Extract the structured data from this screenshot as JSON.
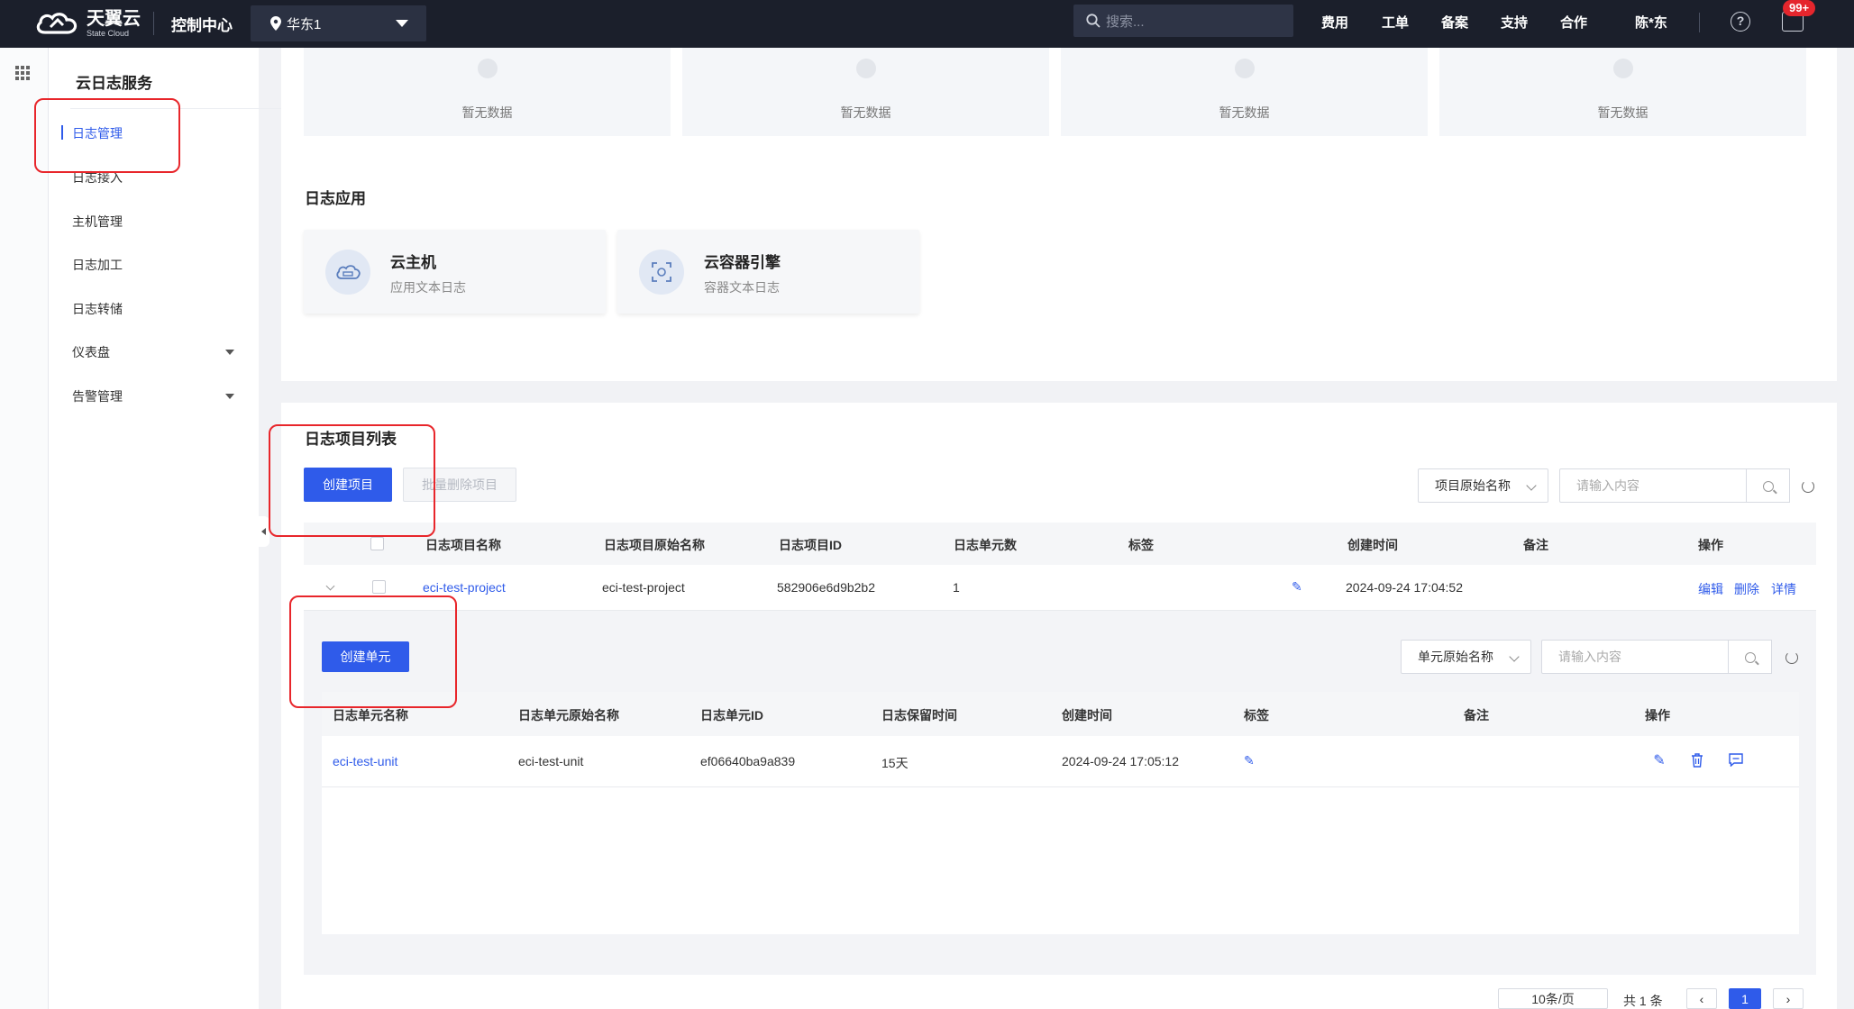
{
  "topbar": {
    "logo_cn": "天翼云",
    "logo_en": "State Cloud",
    "console": "控制中心",
    "region": "华东1",
    "search_placeholder": "搜索...",
    "nav": [
      "费用",
      "工单",
      "备案",
      "支持",
      "合作"
    ],
    "user": "陈*东",
    "badge": "99+",
    "help_glyph": "?"
  },
  "sidebar": {
    "title": "云日志服务",
    "items": [
      {
        "label": "日志管理",
        "active": true
      },
      {
        "label": "日志接入"
      },
      {
        "label": "主机管理"
      },
      {
        "label": "日志加工"
      },
      {
        "label": "日志转储"
      },
      {
        "label": "仪表盘",
        "expandable": true
      },
      {
        "label": "告警管理",
        "expandable": true
      }
    ]
  },
  "overview": {
    "empty_text": [
      "暂无数据",
      "暂无数据",
      "暂无数据",
      "暂无数据"
    ]
  },
  "apps": {
    "title": "日志应用",
    "items": [
      {
        "name": "云主机",
        "desc": "应用文本日志",
        "icon": "cloud-host-icon"
      },
      {
        "name": "云容器引擎",
        "desc": "容器文本日志",
        "icon": "container-engine-icon"
      }
    ]
  },
  "projects": {
    "title": "日志项目列表",
    "create_label": "创建项目",
    "batch_delete_label": "批量删除项目",
    "filter_select": "项目原始名称",
    "search_placeholder": "请输入内容",
    "columns": [
      "日志项目名称",
      "日志项目原始名称",
      "日志项目ID",
      "日志单元数",
      "标签",
      "创建时间",
      "备注",
      "操作"
    ],
    "rows": [
      {
        "name": "eci-test-project",
        "raw_name": "eci-test-project",
        "id": "582906e6d9b2b2",
        "unit_count": "1",
        "created": "2024-09-24 17:04:52",
        "remark": "",
        "actions": [
          "编辑",
          "删除",
          "详情"
        ]
      }
    ]
  },
  "units": {
    "create_label": "创建单元",
    "filter_select": "单元原始名称",
    "search_placeholder": "请输入内容",
    "columns": [
      "日志单元名称",
      "日志单元原始名称",
      "日志单元ID",
      "日志保留时间",
      "创建时间",
      "标签",
      "备注",
      "操作"
    ],
    "rows": [
      {
        "name": "eci-test-unit",
        "raw_name": "eci-test-unit",
        "id": "ef06640ba9a839",
        "retention": "15天",
        "created": "2024-09-24 17:05:12"
      }
    ]
  },
  "pagination": {
    "page_size": "10条/页",
    "total": "共 1 条",
    "current": "1",
    "prev": "‹",
    "next": "›"
  },
  "colors": {
    "accent": "#2f5bea",
    "topbar": "#1b1f2b",
    "annotation": "#e8262b"
  }
}
